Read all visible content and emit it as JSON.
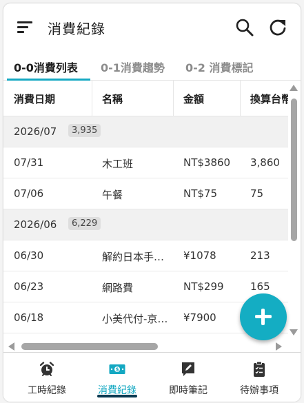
{
  "app": {
    "title": "消費紀錄"
  },
  "colors": {
    "accent": "#14a8c2",
    "fab": "#14adc3",
    "group_row": "#f1f1f1"
  },
  "tabs": [
    {
      "label": "0-0消費列表",
      "active": true
    },
    {
      "label": "0-1消費趨勢",
      "active": false
    },
    {
      "label": "0-2 消費標記",
      "active": false
    }
  ],
  "table": {
    "headers": [
      "消費日期",
      "名稱",
      "金額",
      "換算台幣"
    ],
    "groups": [
      {
        "label": "2026/07",
        "total": "3,935",
        "rows": [
          {
            "date": "07/31",
            "name": "木工班",
            "amount": "NT$3860",
            "twd": "3,860"
          },
          {
            "date": "07/06",
            "name": "午餐",
            "amount": "NT$75",
            "twd": "75"
          }
        ]
      },
      {
        "label": "2026/06",
        "total": "6,229",
        "rows": [
          {
            "date": "06/30",
            "name": "解約日本手…",
            "amount": "¥1078",
            "twd": "213"
          },
          {
            "date": "06/23",
            "name": "網路費",
            "amount": "NT$299",
            "twd": "165"
          },
          {
            "date": "06/18",
            "name": "小美代付-京…",
            "amount": "¥7900",
            "twd": ""
          }
        ]
      }
    ]
  },
  "bottom_nav": [
    {
      "label": "工時紀錄",
      "icon": "alarm-clock-icon",
      "active": false
    },
    {
      "label": "消費紀錄",
      "icon": "money-icon",
      "active": true
    },
    {
      "label": "即時筆記",
      "icon": "note-edit-icon",
      "active": false
    },
    {
      "label": "待辦事項",
      "icon": "clipboard-checklist-icon",
      "active": false
    }
  ]
}
